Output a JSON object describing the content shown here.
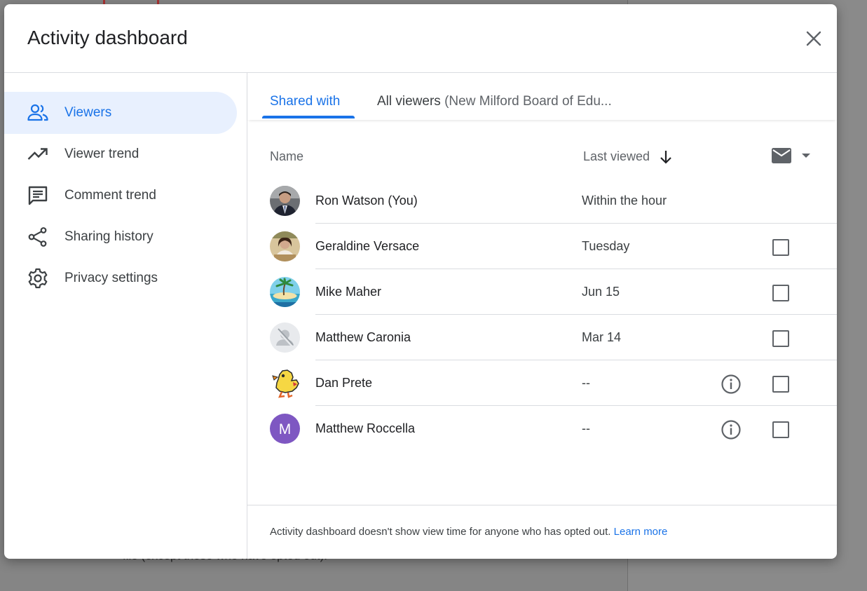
{
  "dialog": {
    "title": "Activity dashboard",
    "close_label": "close"
  },
  "sidebar": {
    "items": [
      {
        "label": "Viewers",
        "icon": "people-icon",
        "active": true
      },
      {
        "label": "Viewer trend",
        "icon": "trending-up-icon"
      },
      {
        "label": "Comment trend",
        "icon": "comment-icon"
      },
      {
        "label": "Sharing history",
        "icon": "share-icon"
      },
      {
        "label": "Privacy settings",
        "icon": "gear-icon"
      }
    ]
  },
  "tabs": {
    "shared_with": "Shared with",
    "all_viewers": "All viewers",
    "all_viewers_org": "(New Milford Board of Edu..."
  },
  "table": {
    "col_name": "Name",
    "col_last_viewed": "Last viewed",
    "sort_icon": "arrow-down-icon",
    "mail_icon": "email-icon",
    "rows": [
      {
        "name": "Ron Watson (You)",
        "last_viewed": "Within the hour",
        "checkbox": false,
        "info": false
      },
      {
        "name": "Geraldine Versace",
        "last_viewed": "Tuesday",
        "checkbox": true,
        "info": false
      },
      {
        "name": "Mike Maher",
        "last_viewed": "Jun 15",
        "checkbox": true,
        "info": false
      },
      {
        "name": "Matthew Caronia",
        "last_viewed": "Mar 14",
        "checkbox": true,
        "info": false
      },
      {
        "name": "Dan Prete",
        "last_viewed": "--",
        "checkbox": true,
        "info": true
      },
      {
        "name": "Matthew Roccella",
        "last_viewed": "--",
        "checkbox": true,
        "info": true,
        "avatar_letter": "M",
        "avatar_color": "#7e57c2"
      }
    ]
  },
  "footer": {
    "text": "Activity dashboard doesn't show view time for anyone who has opted out.",
    "link": "Learn more"
  },
  "background": {
    "bottom_text": "file (except those who have opted out)."
  },
  "colors": {
    "accent": "#1a73e8",
    "active_bg": "#e8f0fe"
  }
}
